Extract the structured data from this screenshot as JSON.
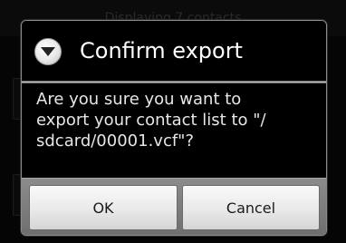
{
  "background": {
    "header_text": "Displaying 7 contacts"
  },
  "dialog": {
    "title": "Confirm export",
    "icon": "dropdown-arrow-icon",
    "message": "Are you sure you want to\nexport your contact list to \"/\nsdcard/00001.vcf\"?",
    "buttons": {
      "ok_label": "OK",
      "cancel_label": "Cancel"
    }
  },
  "colors": {
    "dialog_background": "#000000",
    "button_bar": "#7f7f7f",
    "title_text": "#ffffff"
  }
}
